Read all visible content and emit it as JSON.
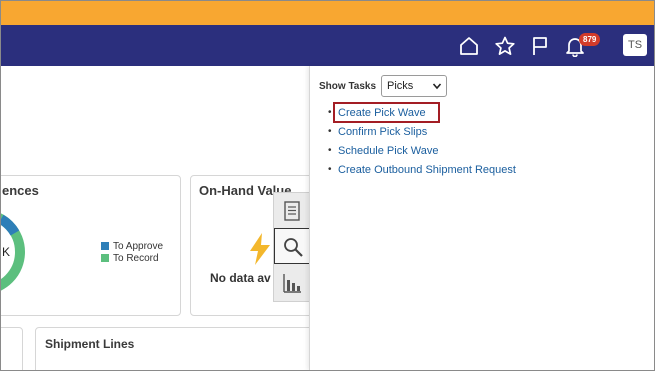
{
  "header": {
    "notifications_count": "879",
    "avatar_initials": "TS",
    "icons": [
      "home-icon",
      "star-icon",
      "flag-icon",
      "bell-icon"
    ]
  },
  "cards": {
    "exceptions": {
      "title_fragment": "ences",
      "donut_center": "K",
      "legend": [
        {
          "label": "To Approve",
          "color": "#2e7fb8"
        },
        {
          "label": "To Record",
          "color": "#5cbf7e"
        }
      ]
    },
    "on_hand": {
      "title": "On-Hand Value",
      "empty_text": "No data av"
    },
    "shipment_lines": {
      "title": "Shipment Lines"
    }
  },
  "tools": [
    "document-icon",
    "search-icon",
    "bar-chart-icon"
  ],
  "tasks_panel": {
    "label": "Show Tasks",
    "selected": "Picks",
    "items": [
      "Create Pick Wave",
      "Confirm Pick Slips",
      "Schedule Pick Wave",
      "Create Outbound Shipment Request"
    ]
  },
  "colors": {
    "accent_orange": "#f8a731",
    "nav_blue": "#2b2f7d",
    "link_blue": "#1a5e9e",
    "highlight_red": "#a31d24"
  }
}
